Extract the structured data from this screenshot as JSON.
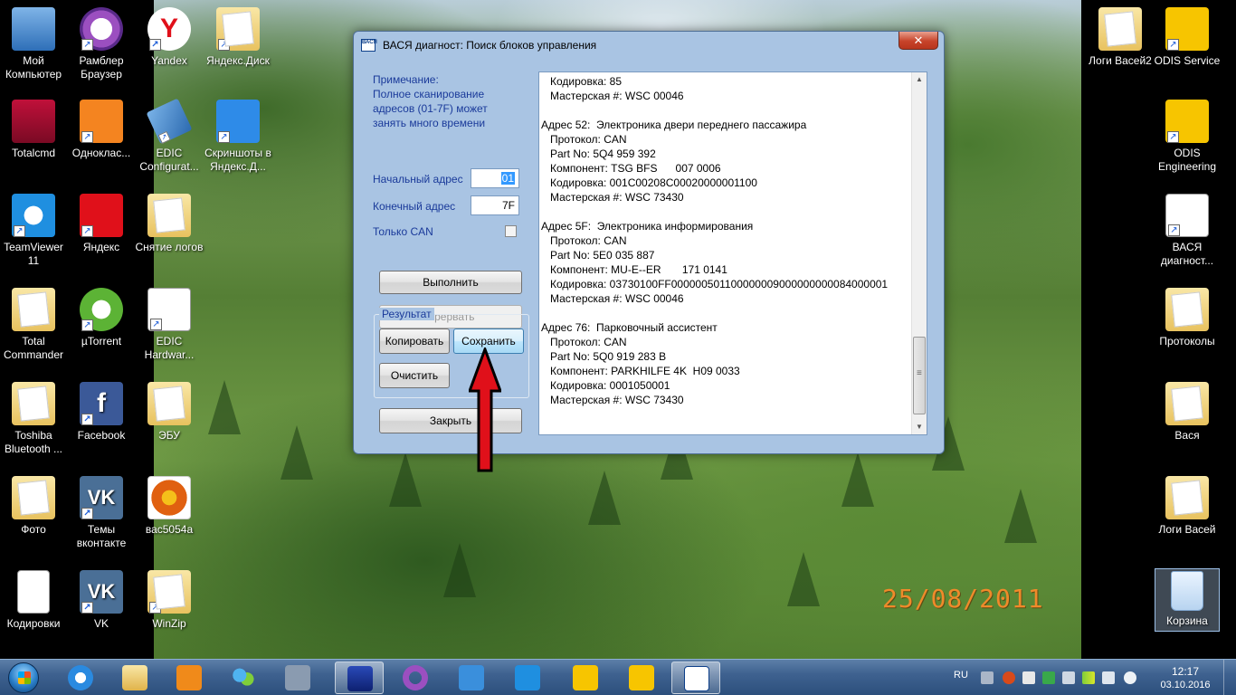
{
  "desktop": {
    "left_icons": [
      {
        "label": "Мой Компьютер"
      },
      {
        "label": "Рамблер Браузер"
      },
      {
        "label": "Yandex"
      },
      {
        "label": "Яндекс.Диск"
      },
      {
        "label": "Totalcmd"
      },
      {
        "label": "Одноклас..."
      },
      {
        "label": "EDIC Configurat..."
      },
      {
        "label": "Скриншоты в Яндекс.Д..."
      },
      {
        "label": "TeamViewer 11"
      },
      {
        "label": "Яндекс"
      },
      {
        "label": "Снятие логов"
      },
      {
        "label": "Total Commander"
      },
      {
        "label": "µTorrent"
      },
      {
        "label": "EDIC Hardwar..."
      },
      {
        "label": "Toshiba Bluetooth ..."
      },
      {
        "label": "Facebook"
      },
      {
        "label": "ЭБУ"
      },
      {
        "label": "Фото"
      },
      {
        "label": "Темы вконтакте"
      },
      {
        "label": "вас5054а"
      },
      {
        "label": "Кодировки"
      },
      {
        "label": "VK"
      },
      {
        "label": "WinZip"
      }
    ],
    "right_icons": [
      {
        "label": "Логи Васей2"
      },
      {
        "label": "ODIS Service"
      },
      {
        "label": "ODIS Engineering"
      },
      {
        "label": "ВАСЯ диагност..."
      },
      {
        "label": "Протоколы"
      },
      {
        "label": "Вася"
      },
      {
        "label": "Логи Васей"
      },
      {
        "label": "Корзина"
      }
    ],
    "date_stamp": "25/08/2011"
  },
  "window": {
    "logo_text": "ВАСЯ",
    "title": "ВАСЯ диагност:  Поиск блоков управления",
    "close_glyph": "✕",
    "note_heading": "Примечание:",
    "note_text": "Полное сканирование адресов (01-7F) может занять много времени",
    "start_label": "Начальный адрес",
    "start_value": "01",
    "end_label": "Конечный адрес",
    "end_value": "7F",
    "can_only_label": "Только CAN",
    "can_only_checked": false,
    "run_button": "Выполнить",
    "abort_button": "Прервать",
    "result_group": "Результат",
    "copy_button": "Копировать",
    "save_button": "Сохранить",
    "clear_button": "Очистить",
    "close_button": "Закрыть",
    "output_lines": [
      "   Кодировка: 85",
      "   Мастерская #: WSC 00046",
      "",
      "Адрес 52:  Электроника двери переднего пассажира",
      "   Протокол: CAN",
      "   Part No: 5Q4 959 392",
      "   Компонент: TSG BFS      007 0006",
      "   Кодировка: 001C00208C00020000001100",
      "   Мастерская #: WSC 73430",
      "",
      "Адрес 5F:  Электроника информирования",
      "   Протокол: CAN",
      "   Part No: 5E0 035 887",
      "   Компонент: MU-E--ER       171 0141",
      "   Кодировка: 03730100FF000000501100000009000000000084000001",
      "   Мастерская #: WSC 00046",
      "",
      "Адрес 76:  Парковочный ассистент",
      "   Протокол: CAN",
      "   Part No: 5Q0 919 283 B",
      "   Компонент: PARKHILFE 4K  H09 0033",
      "   Кодировка: 0001050001",
      "   Мастерская #: WSC 73430"
    ],
    "scroll_up_glyph": "▲",
    "scroll_down_glyph": "▼"
  },
  "taskbar": {
    "language": "RU",
    "time": "12:17",
    "date": "03.10.2016"
  },
  "colors": {
    "arrow": "#e0101a",
    "window_bg": "#a9c4e3",
    "label_blue": "#1a3a9a"
  }
}
